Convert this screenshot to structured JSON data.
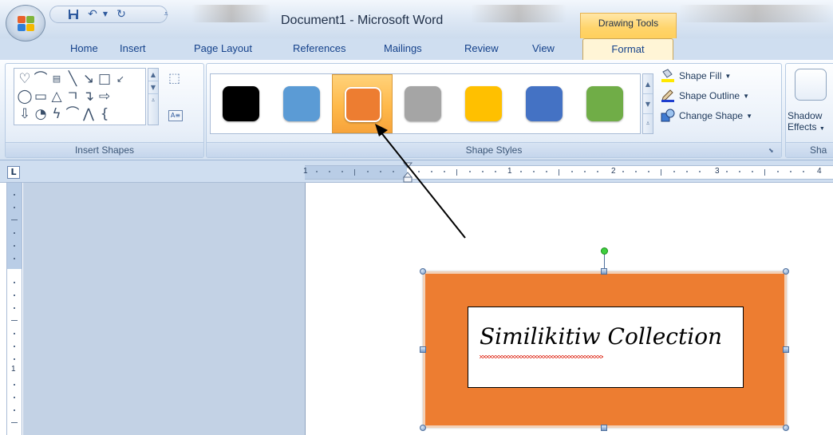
{
  "title_bar": {
    "document_title": "Document1 - Microsoft Word",
    "contextual_tab_group": "Drawing Tools",
    "quick_access": [
      "save-icon",
      "undo-icon",
      "dropdown-arrow",
      "redo-icon",
      "customize-icon"
    ]
  },
  "tabs": [
    "Home",
    "Insert",
    "Page Layout",
    "References",
    "Mailings",
    "Review",
    "View",
    "Format"
  ],
  "active_tab": "Format",
  "ribbon": {
    "insert_shapes": {
      "label": "Insert Shapes",
      "shapes": [
        "heart",
        "arc",
        "text-box",
        "line",
        "arrow-line",
        "rectangle",
        "oval",
        "rounded-rectangle",
        "triangle",
        "elbow-connector",
        "elbow-arrow-connector",
        "right-arrow",
        "down-arrow",
        "teardrop",
        "lightning",
        "curve",
        "freeform",
        "left-brace"
      ]
    },
    "shape_styles": {
      "label": "Shape Styles",
      "swatches": [
        {
          "color": "#000000",
          "selected": false
        },
        {
          "color": "#5b9bd5",
          "selected": false
        },
        {
          "color": "#ed7d31",
          "selected": true
        },
        {
          "color": "#a5a5a5",
          "selected": false
        },
        {
          "color": "#ffc000",
          "selected": false
        },
        {
          "color": "#4472c4",
          "selected": false
        },
        {
          "color": "#70ad47",
          "selected": false
        }
      ],
      "shape_fill": "Shape Fill",
      "shape_outline": "Shape Outline",
      "change_shape": "Change Shape"
    },
    "shadow": {
      "label_line1": "Shadow",
      "label_line2": "Effects",
      "group_label": "Sha"
    }
  },
  "ruler": {
    "numbers": [
      "1",
      "1",
      "2",
      "3",
      "4"
    ]
  },
  "document": {
    "textbox_text": "Similikitiw Collection",
    "shape_fill": "#ed7d31"
  }
}
